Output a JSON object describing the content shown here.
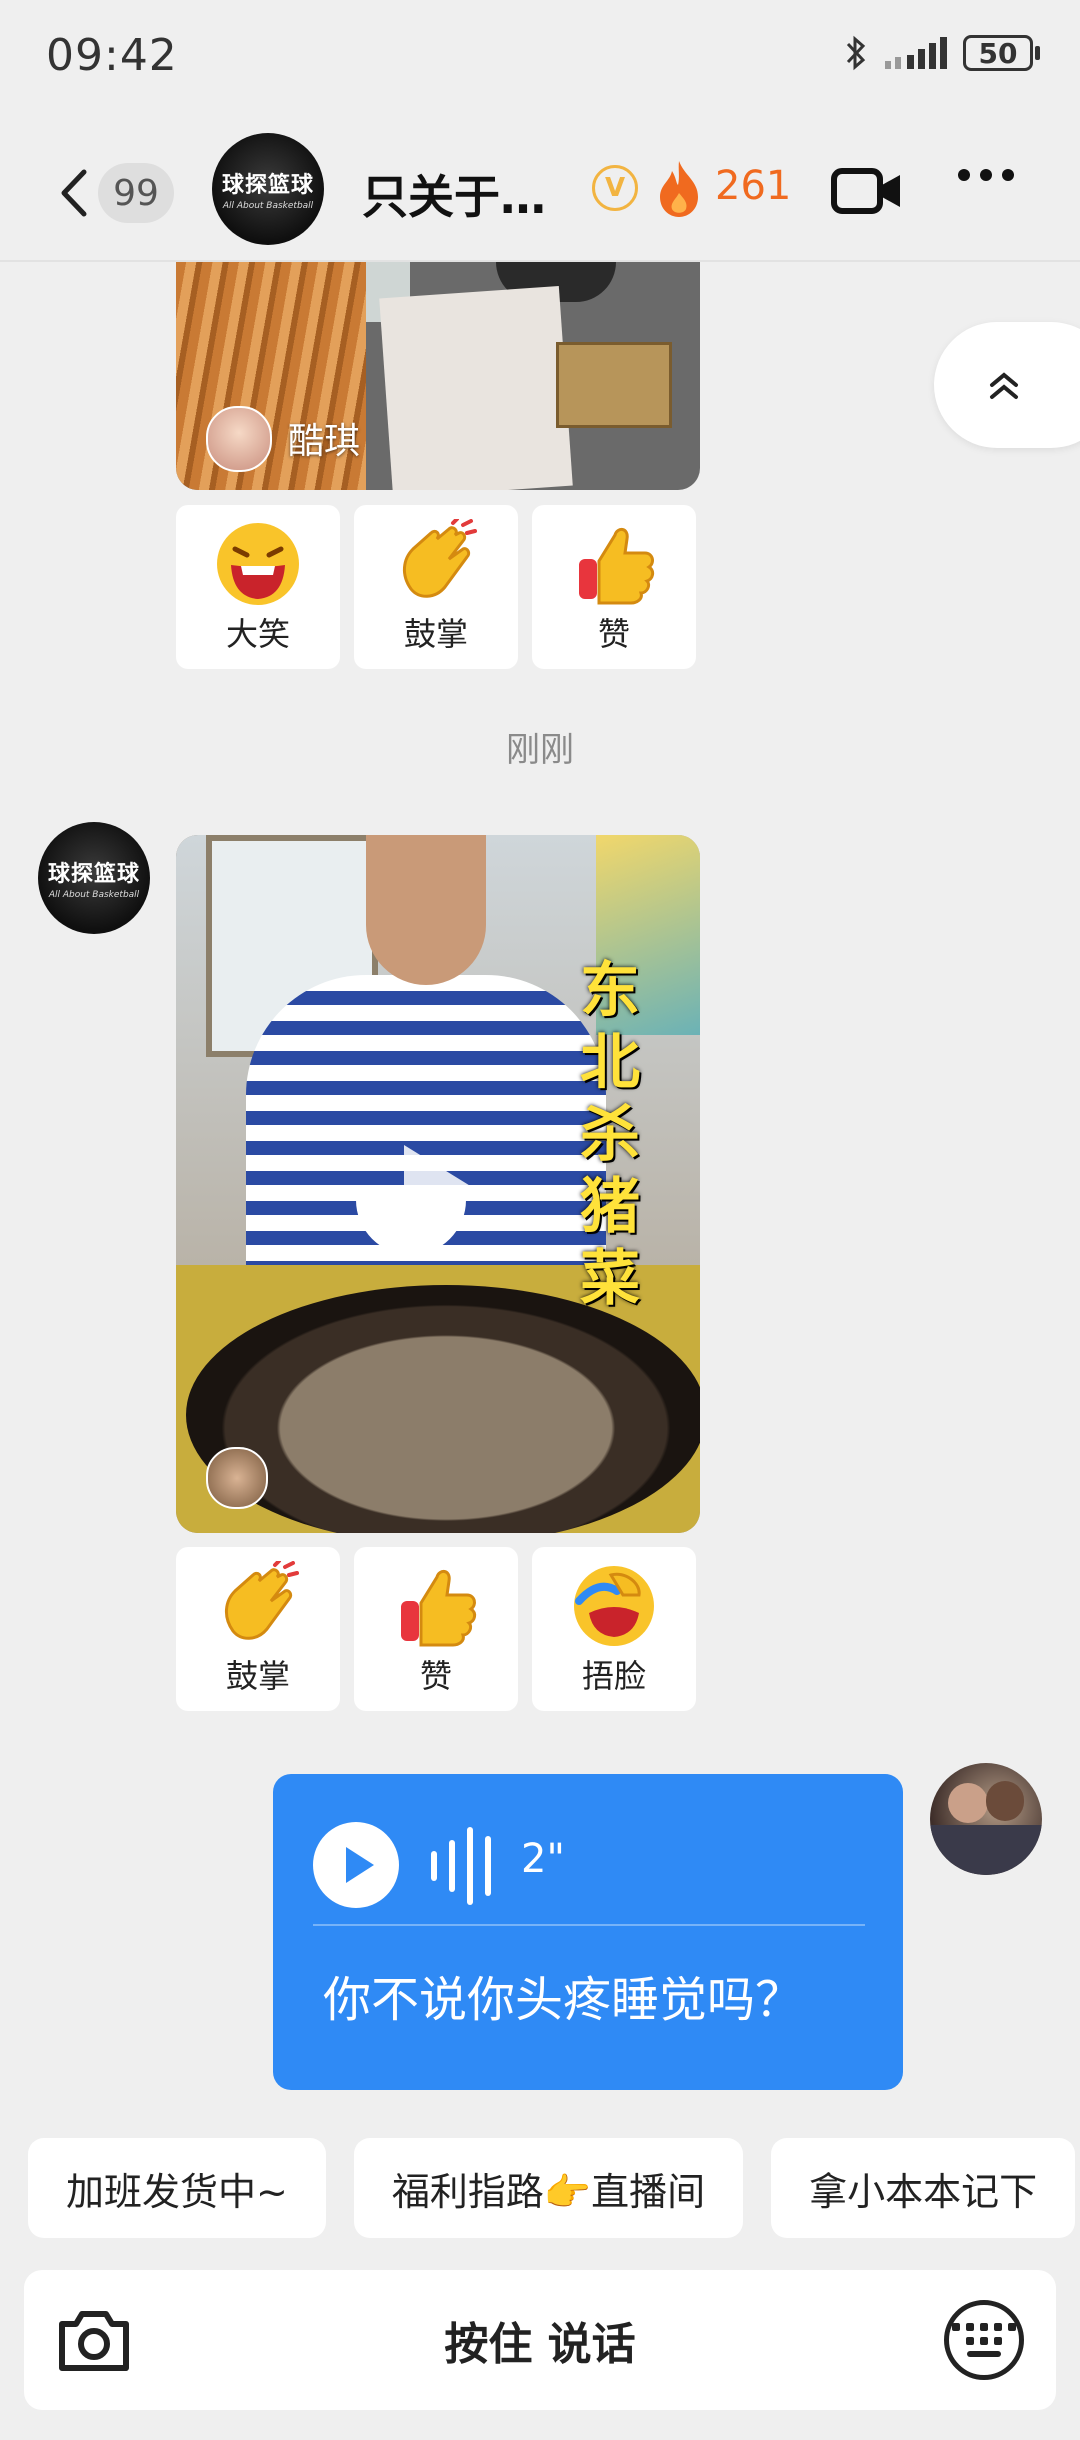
{
  "status_bar": {
    "time": "09:42",
    "battery": "50",
    "icons": [
      "bluetooth-icon",
      "signal-icon",
      "battery-icon"
    ]
  },
  "header": {
    "back_count": "99",
    "title": "只关于…",
    "avatar_logo": "球探篮球",
    "avatar_subtitle": "All About Basketball",
    "vip_badge": "V",
    "fire_count": "261",
    "icons": [
      "back-icon",
      "vip-icon",
      "fire-icon",
      "video-call-icon",
      "more-icon"
    ]
  },
  "messages": [
    {
      "type": "video_card_partial",
      "author_name": "酷琪",
      "reactions": [
        {
          "label": "大笑",
          "icon": "laugh-emoji-icon"
        },
        {
          "label": "鼓掌",
          "icon": "clap-emoji-icon"
        },
        {
          "label": "赞",
          "icon": "thumbs-up-emoji-icon"
        }
      ]
    },
    {
      "type": "timestamp",
      "text": "刚刚"
    },
    {
      "type": "video_card",
      "overlay_text": "东北杀猪菜",
      "reactions": [
        {
          "label": "鼓掌",
          "icon": "clap-emoji-icon"
        },
        {
          "label": "赞",
          "icon": "thumbs-up-emoji-icon"
        },
        {
          "label": "捂脸",
          "icon": "facepalm-emoji-icon"
        }
      ]
    },
    {
      "type": "voice",
      "duration": "2\"",
      "transcript": "你不说你头疼睡觉吗？"
    }
  ],
  "quick_replies": [
    "加班发货中~",
    "福利指路👉直播间",
    "拿小本本记下"
  ],
  "input_bar": {
    "hold_to_talk": "按住 说话"
  },
  "colors": {
    "accent_blue": "#2f8af5",
    "fire_orange": "#f06a1f",
    "vip_gold": "#f2b441",
    "background": "#efefef"
  }
}
